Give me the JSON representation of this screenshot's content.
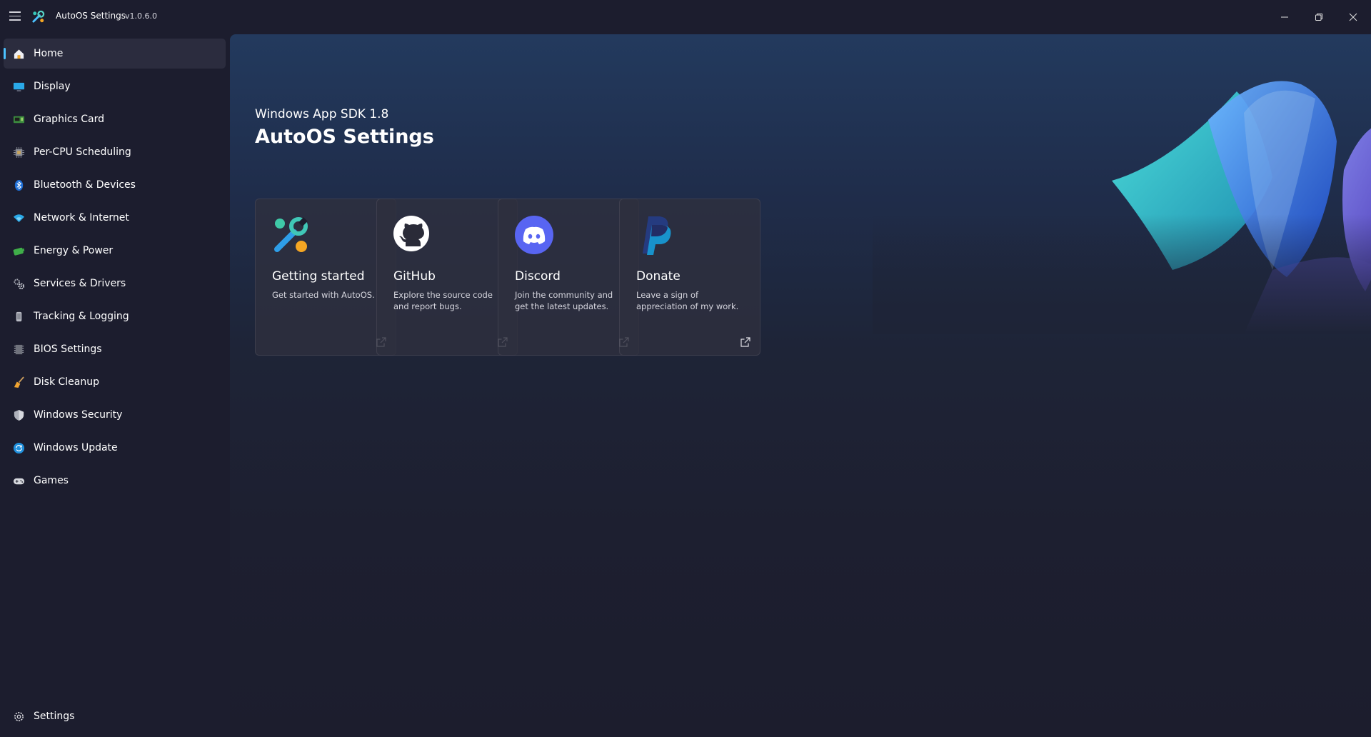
{
  "window": {
    "title": "AutoOS Settings",
    "version": "v1.0.6.0"
  },
  "sidebar": {
    "items": [
      {
        "label": "Home",
        "icon": "home-icon",
        "selected": true
      },
      {
        "label": "Display",
        "icon": "display-icon"
      },
      {
        "label": "Graphics Card",
        "icon": "graphics-card-icon"
      },
      {
        "label": "Per-CPU Scheduling",
        "icon": "cpu-icon"
      },
      {
        "label": "Bluetooth & Devices",
        "icon": "bluetooth-icon"
      },
      {
        "label": "Network & Internet",
        "icon": "wifi-icon"
      },
      {
        "label": "Energy & Power",
        "icon": "battery-icon"
      },
      {
        "label": "Services & Drivers",
        "icon": "gears-icon"
      },
      {
        "label": "Tracking & Logging",
        "icon": "tracking-icon"
      },
      {
        "label": "BIOS Settings",
        "icon": "bios-chip-icon"
      },
      {
        "label": "Disk Cleanup",
        "icon": "broom-icon"
      },
      {
        "label": "Windows Security",
        "icon": "shield-icon"
      },
      {
        "label": "Windows Update",
        "icon": "update-icon"
      },
      {
        "label": "Games",
        "icon": "gamepad-icon"
      }
    ],
    "footer": {
      "label": "Settings",
      "icon": "gear-icon"
    }
  },
  "hero": {
    "subtitle": "Windows App SDK 1.8",
    "title": "AutoOS Settings"
  },
  "cards": [
    {
      "title": "Getting started",
      "description": "Get started with AutoOS.",
      "icon": "wrench-icon"
    },
    {
      "title": "GitHub",
      "description": "Explore the source code and report bugs.",
      "icon": "github-icon"
    },
    {
      "title": "Discord",
      "description": "Join the community and get the latest updates.",
      "icon": "discord-icon"
    },
    {
      "title": "Donate",
      "description": "Leave a sign of appreciation of my work.",
      "icon": "paypal-icon"
    }
  ],
  "colors": {
    "accent": "#4cc2ff",
    "background": "#1c1d2e",
    "selected_item": "#2b2c3e"
  }
}
